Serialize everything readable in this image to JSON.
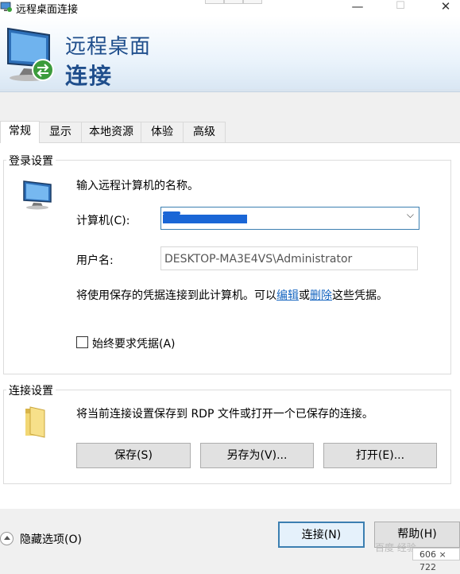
{
  "window": {
    "title": "远程桌面连接",
    "controls": {
      "minimize": "—",
      "maximize": "☐",
      "close": "✕"
    }
  },
  "banner": {
    "line1": "远程桌面",
    "line2": "连接"
  },
  "tabs": [
    {
      "label": "常规",
      "active": true
    },
    {
      "label": "显示",
      "active": false
    },
    {
      "label": "本地资源",
      "active": false
    },
    {
      "label": "体验",
      "active": false
    },
    {
      "label": "高级",
      "active": false
    }
  ],
  "login": {
    "group_title": "登录设置",
    "prompt": "输入远程计算机的名称。",
    "computer_label": "计算机(C):",
    "computer_value_redacted": true,
    "username_label": "用户名:",
    "username_value": "DESKTOP-MA3E4VS\\Administrator",
    "cred_note_pre": "将使用保存的凭据连接到此计算机。可以",
    "cred_edit_link": "编辑",
    "cred_or": "或",
    "cred_delete_link": "删除",
    "cred_note_post": "这些凭据。",
    "always_ask_label": "始终要求凭据(A)",
    "always_ask_checked": false
  },
  "connection": {
    "group_title": "连接设置",
    "description": "将当前连接设置保存到 RDP 文件或打开一个已保存的连接。",
    "save_label": "保存(S)",
    "save_as_label": "另存为(V)...",
    "open_label": "打开(E)..."
  },
  "bottom": {
    "hide_options_label": "隐藏选项(O)",
    "connect_label": "连接(N)",
    "help_label": "帮助(H)"
  },
  "overlay": {
    "size_badge": "606 × 722",
    "watermark": "百度 经验"
  },
  "colors": {
    "accent": "#1f4e8c",
    "link": "#1565c0",
    "focus": "#3c7fb1"
  }
}
